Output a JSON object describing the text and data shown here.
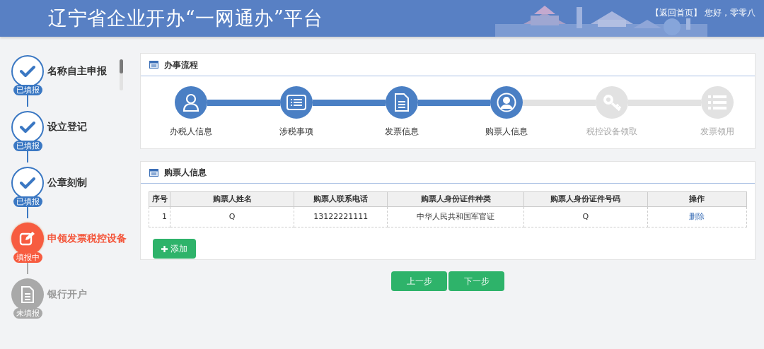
{
  "header": {
    "title": "辽宁省企业开办“一网通办”平台",
    "home_link": "【返回首页】",
    "greeting": "您好，零零八"
  },
  "sidebar": {
    "steps": [
      {
        "label": "名称自主申报",
        "badge": "已填报",
        "kind": "done"
      },
      {
        "label": "设立登记",
        "badge": "已填报",
        "kind": "done"
      },
      {
        "label": "公章刻制",
        "badge": "已填报",
        "kind": "done"
      },
      {
        "label": "申领发票税控设备",
        "badge": "填报中",
        "kind": "current"
      },
      {
        "label": "银行开户",
        "badge": "未填报",
        "kind": "todo"
      }
    ]
  },
  "process": {
    "title": "办事流程",
    "steps": [
      {
        "label": "办税人信息",
        "kind": "user",
        "done": true
      },
      {
        "label": "涉税事项",
        "kind": "card",
        "done": true
      },
      {
        "label": "发票信息",
        "kind": "document",
        "done": true
      },
      {
        "label": "购票人信息",
        "kind": "profile",
        "done": true
      },
      {
        "label": "税控设备领取",
        "kind": "key",
        "done": false
      },
      {
        "label": "发票领用",
        "kind": "list",
        "done": false
      }
    ]
  },
  "buyers": {
    "title": "购票人信息",
    "table": {
      "columns": [
        "序号",
        "购票人姓名",
        "购票人联系电话",
        "购票人身份证件种类",
        "购票人身份证件号码",
        "操作"
      ],
      "rows": [
        {
          "cells": [
            "1",
            "Q",
            "13122221111",
            "中华人民共和国军官证",
            "Q"
          ],
          "action": "删除"
        }
      ]
    },
    "add_button": "添加"
  },
  "buttons": [
    "上一步",
    "下一步"
  ]
}
